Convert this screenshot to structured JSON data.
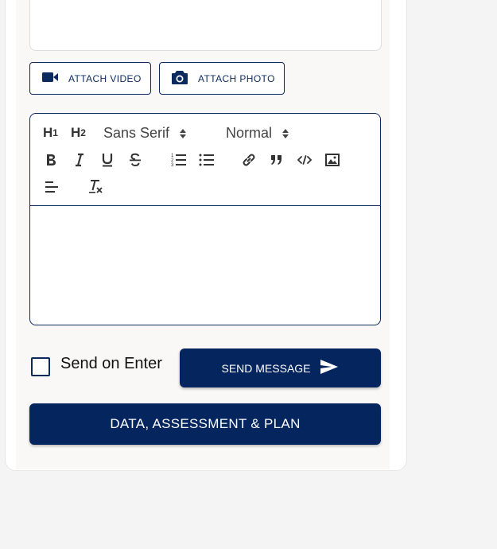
{
  "attachments": {
    "video_label": "ATTACH VIDEO",
    "photo_label": "ATTACH PHOTO"
  },
  "editor": {
    "toolbar": {
      "h1_label": "H",
      "h1_sub": "1",
      "h2_label": "H",
      "h2_sub": "2",
      "font_value": "Sans Serif",
      "size_value": "Normal",
      "icons": [
        "bold-icon",
        "italic-icon",
        "underline-icon",
        "strike-icon",
        "ordered-list-icon",
        "bullet-list-icon",
        "link-icon",
        "blockquote-icon",
        "code-block-icon",
        "image-icon",
        "align-icon",
        "clear-format-icon"
      ]
    },
    "content": ""
  },
  "send_on_enter": {
    "label": "Send on Enter",
    "checked": false
  },
  "send_button": {
    "label": "SEND MESSAGE"
  },
  "dap_button": {
    "label": "DATA, ASSESSMENT & PLAN"
  },
  "colors": {
    "primary": "#05255f",
    "border": "#0d2a5e",
    "background": "#f4f4f5"
  }
}
